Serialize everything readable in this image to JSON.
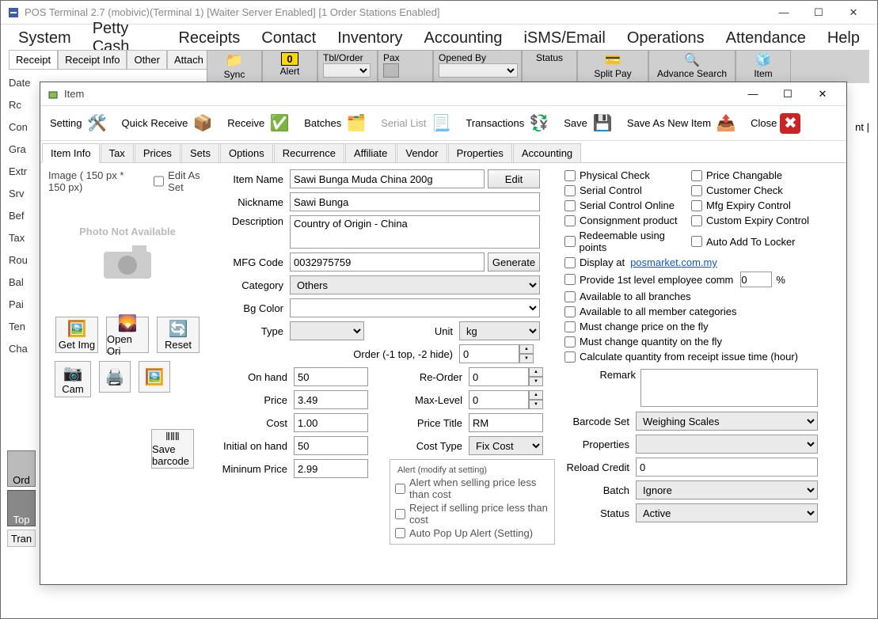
{
  "main": {
    "title": "POS Terminal 2.7 (mobivic)(Terminal 1) [Waiter Server Enabled] [1 Order Stations Enabled]",
    "menu": [
      "System",
      "Petty Cash",
      "Receipts",
      "Contact",
      "Inventory",
      "Accounting",
      "iSMS/Email",
      "Operations",
      "Attendance",
      "Help"
    ],
    "subtabs": [
      "Receipt",
      "Receipt Info",
      "Other",
      "Attach"
    ],
    "tool_labels": {
      "sync": "Sync",
      "alert": "Alert",
      "tbl": "Tbl/Order",
      "pax": "Pax",
      "opened": "Opened By",
      "status": "Status",
      "split": "Split Pay",
      "search": "Advance Search",
      "item": "Item"
    },
    "left_fields": [
      "Date",
      "Rc",
      "Con",
      "Gra",
      "Extr",
      "Srv",
      "Bef",
      "Tax",
      "Rou",
      "Bal",
      "Pai",
      "Ten",
      "Cha"
    ],
    "bottom_left": [
      "Ord",
      "Top",
      "Tran"
    ],
    "right_label": "nt |"
  },
  "dialog": {
    "title": "Item",
    "toolbar": {
      "setting": "Setting",
      "quick": "Quick Receive",
      "receive": "Receive",
      "batches": "Batches",
      "serial": "Serial List",
      "trans": "Transactions",
      "save": "Save",
      "saveas": "Save As New Item",
      "close": "Close"
    },
    "tabs": [
      "Item Info",
      "Tax",
      "Prices",
      "Sets",
      "Options",
      "Recurrence",
      "Affiliate",
      "Vendor",
      "Properties",
      "Accounting"
    ],
    "img_hdr": "Image ( 150 px * 150 px)",
    "edit_as_set": "Edit As Set",
    "photo_na": "Photo Not Available",
    "img_btns": {
      "get": "Get Img",
      "open": "Open Ori",
      "reset": "Reset",
      "cam": "Cam",
      "savebc": "Save barcode"
    },
    "labels": {
      "item_name": "Item Name",
      "nickname": "Nickname",
      "desc": "Description",
      "mfg": "MFG Code",
      "gen": "Generate",
      "cat": "Category",
      "bg": "Bg Color",
      "type": "Type",
      "unit": "Unit",
      "order": "Order (-1 top, -2 hide)",
      "onhand": "On hand",
      "reorder": "Re-Order",
      "price": "Price",
      "maxlevel": "Max-Level",
      "cost": "Cost",
      "pricetitle": "Price Title",
      "initial": "Initial on hand",
      "costtype": "Cost Type",
      "minprice": "Mininum Price",
      "edit": "Edit",
      "alert_leg": "Alert (modify at setting)",
      "alert1": "Alert when selling price less than cost",
      "alert2": "Reject if selling price less than cost",
      "alert3": "Auto Pop Up Alert (Setting)"
    },
    "values": {
      "item_name": "Sawi Bunga Muda China 200g",
      "nickname": "Sawi Bunga",
      "desc": "Country of Origin - China",
      "mfg": "0032975759",
      "cat": "Others",
      "type": "",
      "unit": "kg",
      "order": "0",
      "onhand": "50",
      "reorder": "0",
      "price": "3.49",
      "maxlevel": "0",
      "cost": "1.00",
      "pricetitle": "RM",
      "initial": "50",
      "costtype": "Fix Cost",
      "minprice": "2.99"
    },
    "checks": [
      {
        "l": "Physical Check",
        "r": "Price Changable"
      },
      {
        "l": "Serial Control",
        "r": "Customer Check"
      },
      {
        "l": "Serial Control Online",
        "r": "Mfg Expiry Control"
      },
      {
        "l": "Consignment product",
        "r": "Custom Expiry Control"
      },
      {
        "l": "Redeemable using points",
        "r": "Auto Add To Locker"
      }
    ],
    "fullchecks": [
      {
        "t": "Display at",
        "link": "posmarket.com.my"
      },
      {
        "t": "Provide 1st level employee comm",
        "pct": "0"
      },
      {
        "t": "Available to all branches"
      },
      {
        "t": "Available to all member categories"
      },
      {
        "t": "Must change price on the fly"
      },
      {
        "t": "Must change quantity on the fly"
      },
      {
        "t": "Calculate quantity from receipt issue time (hour)"
      }
    ],
    "pct_suffix": "%",
    "botlabels": {
      "remark": "Remark",
      "barcode": "Barcode Set",
      "props": "Properties",
      "reload": "Reload Credit",
      "batch": "Batch",
      "status": "Status"
    },
    "botvalues": {
      "barcode": "Weighing Scales",
      "reload": "0",
      "batch": "Ignore",
      "status": "Active"
    }
  }
}
